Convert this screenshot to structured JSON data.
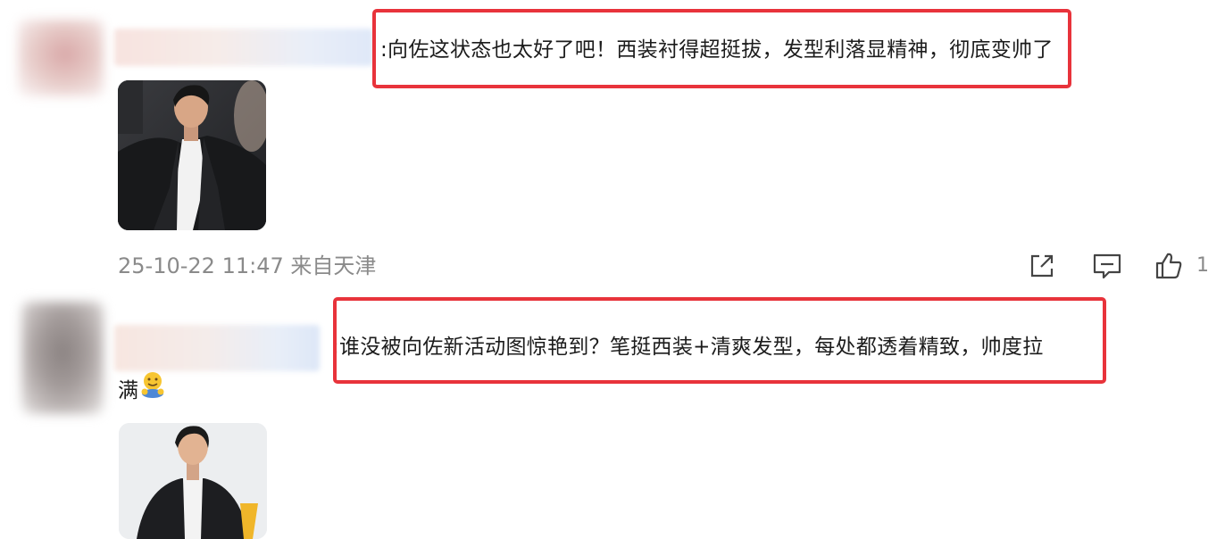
{
  "comments": [
    {
      "text": ":向佐这状态也太好了吧！西装衬得超挺拔，发型利落显精神，彻底变帅了",
      "meta": "25-10-22 11:47 来自天津",
      "like_count": "1"
    },
    {
      "text_line1": ":谁没被向佐新活动图惊艳到？笔挺西装+清爽发型，每处都透着精致，帅度拉",
      "text_line2": "满"
    }
  ],
  "colors": {
    "highlight": "#e8333b",
    "meta_text": "#8a8a8a",
    "comment_text": "#1c1c1c"
  },
  "icons": [
    "share-icon",
    "comment-icon",
    "thumbs-up-icon",
    "hug-emoji-icon"
  ]
}
